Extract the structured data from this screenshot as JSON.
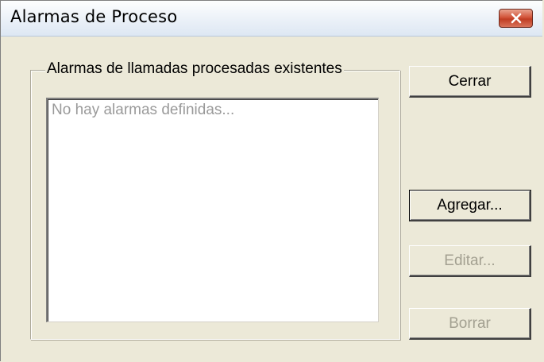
{
  "window": {
    "title": "Alarmas de Proceso"
  },
  "group": {
    "label": "Alarmas de llamadas procesadas existentes",
    "list_placeholder": "No hay alarmas definidas...",
    "items": []
  },
  "buttons": {
    "close_label": "Cerrar",
    "add_label": "Agregar...",
    "edit_label": "Editar...",
    "delete_label": "Borrar",
    "edit_enabled": false,
    "delete_enabled": false
  },
  "colors": {
    "dialog_background": "#ece9d8",
    "close_button": "#c03d23",
    "disabled_text": "#a3a091",
    "placeholder_text": "#9a9a9a"
  },
  "icons": {
    "title_close": "close-icon"
  }
}
